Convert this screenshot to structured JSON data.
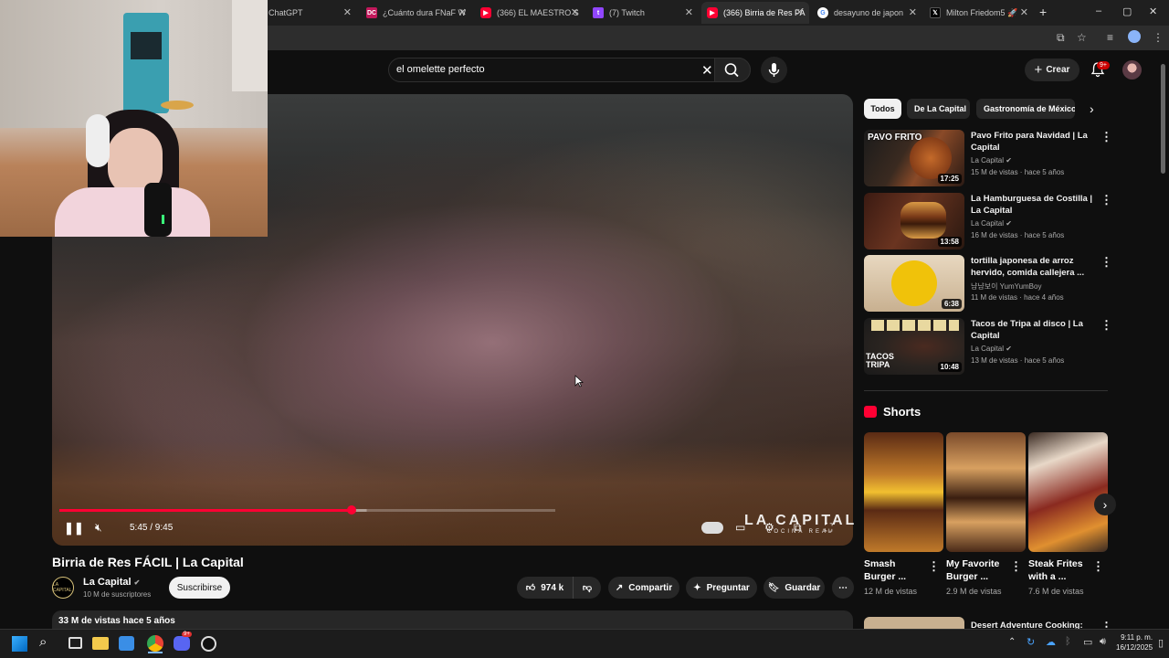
{
  "browser": {
    "tabs": [
      {
        "label": "ChatGPT",
        "favicon": "chatgpt-icon"
      },
      {
        "label": "¿Cuánto dura FNaF W",
        "favicon": "dc-icon"
      },
      {
        "label": "(366) EL MAESTRO S",
        "favicon": "youtube-icon"
      },
      {
        "label": "(7) Twitch",
        "favicon": "twitch-icon"
      },
      {
        "label": "(366) Birria de Res FÁ",
        "favicon": "youtube-icon",
        "active": true
      },
      {
        "label": "desayuno de japon",
        "favicon": "google-icon"
      },
      {
        "label": "Milton Friedom5 🚀",
        "favicon": "x-icon"
      }
    ],
    "new_tab": "+",
    "window_controls": [
      "–",
      "▢",
      "✕"
    ]
  },
  "youtube": {
    "search_value": "el omelette perfecto",
    "create_label": "Crear",
    "notifications_badge": "9+"
  },
  "player": {
    "time": "5:45 / 9:45",
    "progress": 0.59,
    "buffered": 0.62,
    "watermark": "LA CAPITAL",
    "watermark_sub": "COCINA REAL"
  },
  "video": {
    "title": "Birria de Res FÁCIL | La Capital",
    "channel": "La Capital",
    "channel_avatar_text": "LA CAPITAL",
    "subscribers": "10 M de suscriptores",
    "subscribe_label": "Suscribirse",
    "likes": "974 k",
    "share_label": "Compartir",
    "ask_label": "Preguntar",
    "save_label": "Guardar",
    "views": "33 M de vistas  hace 5 años"
  },
  "sidebar": {
    "chips": [
      {
        "label": "Todos",
        "active": true
      },
      {
        "label": "De La Capital"
      },
      {
        "label": "Gastronomía de México"
      }
    ],
    "related": [
      {
        "title": "Pavo Frito para Navidad | La Capital",
        "channel": "La Capital",
        "verified": true,
        "meta": "15 M de vistas · hace 5 años",
        "duration": "17:25",
        "thumb_text": "PAVO FRITO"
      },
      {
        "title": "La Hamburguesa de Costilla | La Capital",
        "channel": "La Capital",
        "verified": true,
        "meta": "16 M de vistas · hace 5 años",
        "duration": "13:58",
        "thumb_text": ""
      },
      {
        "title": "tortilla japonesa de arroz hervido, comida callejera ...",
        "channel": "냠냠보이 YumYumBoy",
        "verified": false,
        "meta": "11 M de vistas · hace 4 años",
        "duration": "6:38",
        "thumb_text": ""
      },
      {
        "title": "Tacos de Tripa al disco | La Capital",
        "channel": "La Capital",
        "verified": true,
        "meta": "13 M de vistas · hace 5 años",
        "duration": "10:48",
        "thumb_text": "TACOS TRIPA"
      }
    ],
    "shorts_title": "Shorts",
    "shorts": [
      {
        "title": "Smash Burger ...",
        "views": "12 M de vistas"
      },
      {
        "title": "My Favorite Burger ...",
        "views": "2.9 M de vistas"
      },
      {
        "title": "Steak Frites with a ...",
        "views": "7.6 M de vistas"
      }
    ],
    "next_item_title": "Desert Adventure Cooking:"
  },
  "taskbar": {
    "time": "9:11 p. m.",
    "date": "16/12/2025",
    "discord_badge": "9+"
  }
}
